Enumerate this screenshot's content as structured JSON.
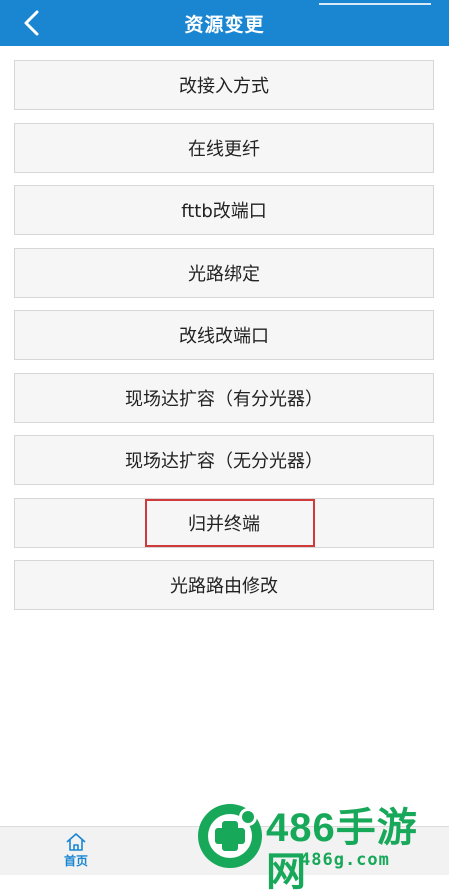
{
  "header": {
    "title": "资源变更",
    "back_icon": "back-arrow-icon"
  },
  "menu": {
    "items": [
      {
        "label": "改接入方式"
      },
      {
        "label": "在线更纤"
      },
      {
        "label": "fttb改端口"
      },
      {
        "label": "光路绑定"
      },
      {
        "label": "改线改端口"
      },
      {
        "label": "现场达扩容（有分光器）"
      },
      {
        "label": "现场达扩容（无分光器）"
      },
      {
        "label": "归并终端"
      },
      {
        "label": "光路路由修改"
      }
    ],
    "highlighted_item": "归并终端"
  },
  "tabbar": {
    "home_label": "首页",
    "home_icon": "home-icon"
  },
  "watermark": {
    "title": "486手游网",
    "url": "486g.com"
  },
  "colors": {
    "header": "#1a86d2",
    "highlight": "#cf3b3b",
    "watermark": "#18a85a"
  }
}
